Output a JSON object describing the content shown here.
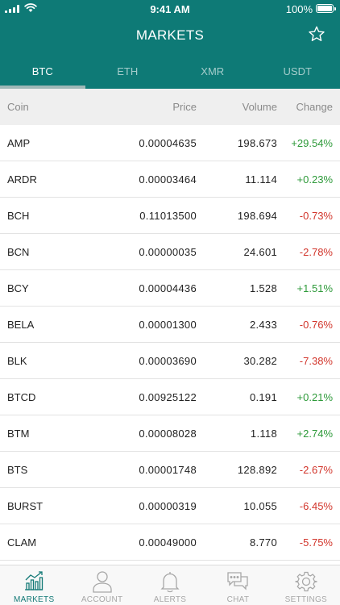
{
  "status_bar": {
    "time": "9:41 AM",
    "battery": "100%"
  },
  "header": {
    "title": "MARKETS"
  },
  "tabs": [
    {
      "label": "BTC",
      "active": true
    },
    {
      "label": "ETH",
      "active": false
    },
    {
      "label": "XMR",
      "active": false
    },
    {
      "label": "USDT",
      "active": false
    }
  ],
  "columns": {
    "coin": "Coin",
    "price": "Price",
    "volume": "Volume",
    "change": "Change"
  },
  "rows": [
    {
      "coin": "AMP",
      "price": "0.00004635",
      "volume": "198.673",
      "change": "+29.54%"
    },
    {
      "coin": "ARDR",
      "price": "0.00003464",
      "volume": "11.114",
      "change": "+0.23%"
    },
    {
      "coin": "BCH",
      "price": "0.11013500",
      "volume": "198.694",
      "change": "-0.73%"
    },
    {
      "coin": "BCN",
      "price": "0.00000035",
      "volume": "24.601",
      "change": "-2.78%"
    },
    {
      "coin": "BCY",
      "price": "0.00004436",
      "volume": "1.528",
      "change": "+1.51%"
    },
    {
      "coin": "BELA",
      "price": "0.00001300",
      "volume": "2.433",
      "change": "-0.76%"
    },
    {
      "coin": "BLK",
      "price": "0.00003690",
      "volume": "30.282",
      "change": "-7.38%"
    },
    {
      "coin": "BTCD",
      "price": "0.00925122",
      "volume": "0.191",
      "change": "+0.21%"
    },
    {
      "coin": "BTM",
      "price": "0.00008028",
      "volume": "1.118",
      "change": "+2.74%"
    },
    {
      "coin": "BTS",
      "price": "0.00001748",
      "volume": "128.892",
      "change": "-2.67%"
    },
    {
      "coin": "BURST",
      "price": "0.00000319",
      "volume": "10.055",
      "change": "-6.45%"
    },
    {
      "coin": "CLAM",
      "price": "0.00049000",
      "volume": "8.770",
      "change": "-5.75%"
    }
  ],
  "tab_bar": [
    {
      "label": "MARKETS",
      "icon": "chart-icon",
      "active": true
    },
    {
      "label": "ACCOUNT",
      "icon": "person-icon",
      "active": false
    },
    {
      "label": "ALERTS",
      "icon": "bell-icon",
      "active": false
    },
    {
      "label": "CHAT",
      "icon": "chat-icon",
      "active": false
    },
    {
      "label": "SETTINGS",
      "icon": "gear-icon",
      "active": false
    }
  ],
  "colors": {
    "header_bg": "#0e7a76",
    "positive": "#2e9a3a",
    "negative": "#d2352b",
    "tab_active": "#147a77",
    "tab_inactive": "#a7a7a7"
  }
}
